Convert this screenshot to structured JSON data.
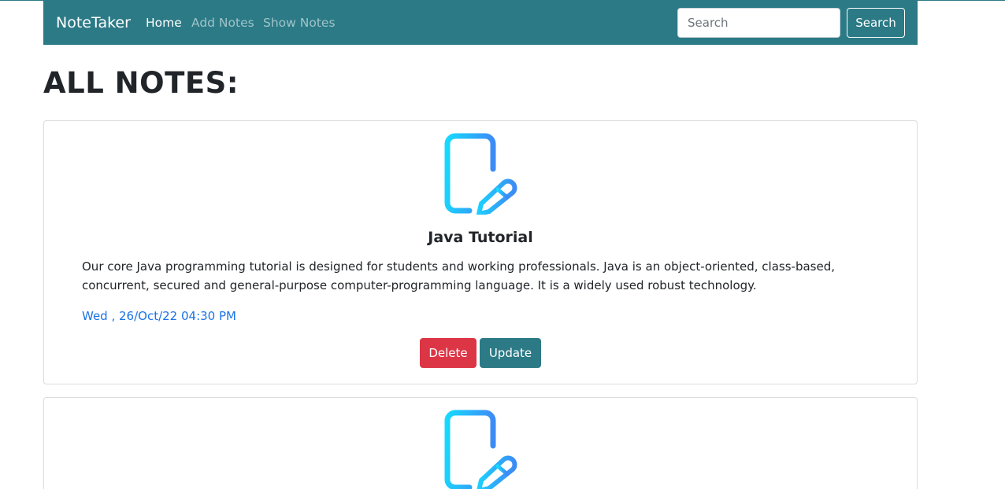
{
  "navbar": {
    "brand": "NoteTaker",
    "links": [
      {
        "label": "Home",
        "active": true
      },
      {
        "label": "Add Notes",
        "active": false
      },
      {
        "label": "Show Notes",
        "active": false
      }
    ],
    "search": {
      "placeholder": "Search",
      "value": "",
      "button_label": "Search"
    }
  },
  "page": {
    "title": "ALL NOTES:"
  },
  "notes": [
    {
      "icon": "note-edit-icon",
      "title": "Java Tutorial",
      "content": "Our core Java programming tutorial is designed for students and working professionals. Java is an object-oriented, class-based, concurrent, secured and general-purpose computer-programming language. It is a widely used robust technology.",
      "date": "Wed , 26/Oct/22 04:30 PM",
      "delete_label": "Delete",
      "update_label": "Update"
    },
    {
      "icon": "note-edit-icon"
    }
  ],
  "colors": {
    "navbar": "#2b7a86",
    "danger": "#dc3545",
    "date_text": "#1a73e8",
    "icon_gradient_start": "#17d9ff",
    "icon_gradient_end": "#3d8bf5"
  }
}
